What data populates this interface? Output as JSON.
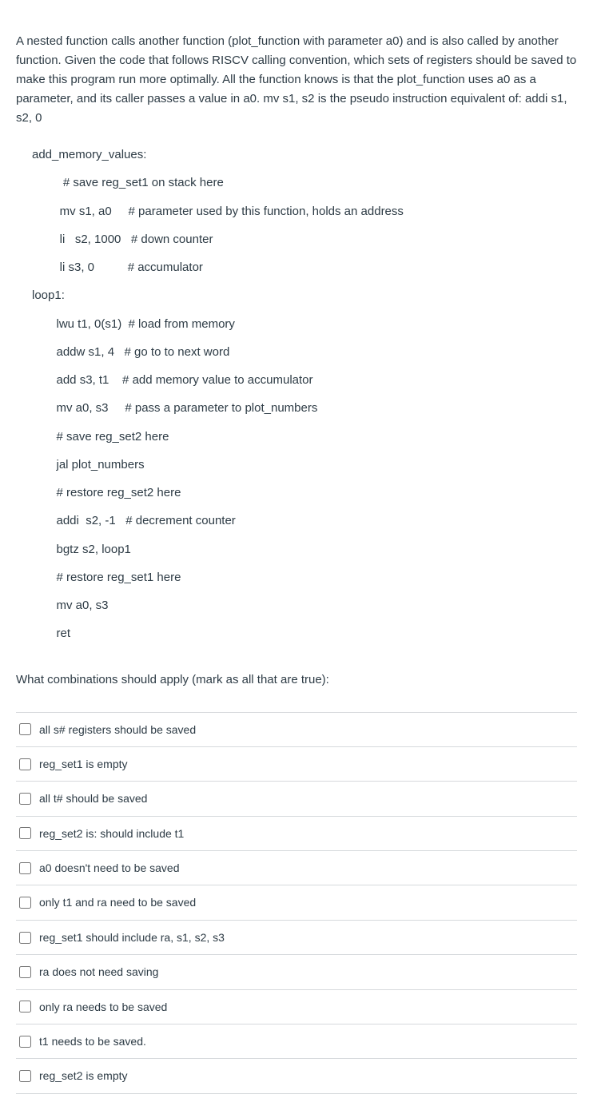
{
  "question": "A nested function calls another function (plot_function with parameter a0) and is also called by another function.  Given the code that follows  RISCV calling convention, which sets of registers should be saved to make this program run more optimally.   All the function knows  is that the plot_function uses a0 as a parameter, and its caller passes a value in a0.  mv s1, s2    is the pseudo instruction equivalent of:  addi s1, s2, 0",
  "code": {
    "l01": "add_memory_values:",
    "l02": "     # save reg_set1 on stack here",
    "l03": "    mv s1, a0     # parameter used by this function, holds an address",
    "l04": "    li   s2, 1000   # down counter  ",
    "l05": "    li s3, 0          # accumulator ",
    "l06": "loop1: ",
    "l07": "   lwu t1, 0(s1)  # load from memory   ",
    "l08": "   addw s1, 4   # go to to next word",
    "l09": "   add s3, t1    # add memory value to accumulator",
    "l10": "   mv a0, s3     # pass a parameter to plot_numbers",
    "l11": "   # save reg_set2 here",
    "l12": "   jal plot_numbers",
    "l13": "   # restore reg_set2 here",
    "l14": "   addi  s2, -1   # decrement counter",
    "l15": "   bgtz s2, loop1",
    "l16": "   # restore reg_set1 here ",
    "l17": "   mv a0, s3",
    "l18": "   ret"
  },
  "prompt": "What combinations should apply (mark as all that are true):",
  "options": [
    "all s# registers should be saved",
    "reg_set1 is empty",
    "all t# should be saved",
    "reg_set2 is: should include t1",
    "a0 doesn't need to be saved",
    "only t1 and ra need to be saved",
    "reg_set1 should include ra, s1, s2, s3",
    "ra does not need saving",
    "only ra needs to be saved",
    "t1 needs to be saved.",
    "reg_set2 is empty"
  ]
}
